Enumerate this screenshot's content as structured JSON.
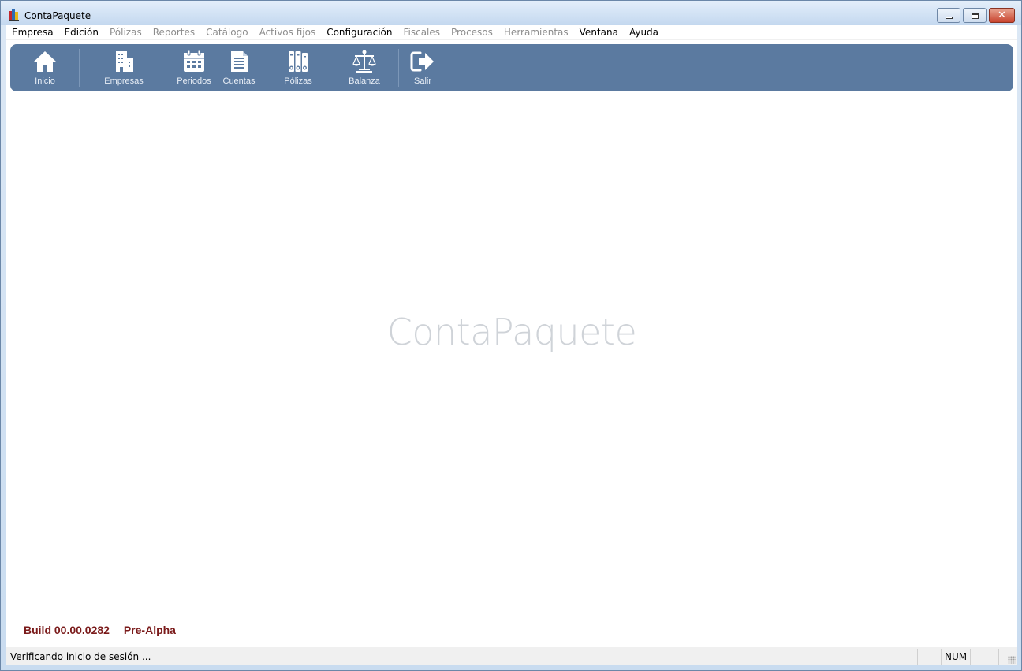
{
  "window": {
    "title": "ContaPaquete",
    "controls": {
      "minimize": "minimize",
      "maximize": "maximize",
      "close": "✕"
    }
  },
  "menu": [
    {
      "label": "Empresa",
      "enabled": true
    },
    {
      "label": "Edición",
      "enabled": true
    },
    {
      "label": "Pólizas",
      "enabled": false
    },
    {
      "label": "Reportes",
      "enabled": false
    },
    {
      "label": "Catálogo",
      "enabled": false
    },
    {
      "label": "Activos fijos",
      "enabled": false
    },
    {
      "label": "Configuración",
      "enabled": true
    },
    {
      "label": "Fiscales",
      "enabled": false
    },
    {
      "label": "Procesos",
      "enabled": false
    },
    {
      "label": "Herramientas",
      "enabled": false
    },
    {
      "label": "Ventana",
      "enabled": true
    },
    {
      "label": "Ayuda",
      "enabled": true
    }
  ],
  "toolbar": {
    "inicio": {
      "label": "Inicio",
      "icon": "home-icon"
    },
    "empresas": {
      "label": "Empresas",
      "icon": "building-icon"
    },
    "periodos": {
      "label": "Periodos",
      "icon": "calendar-icon"
    },
    "cuentas": {
      "label": "Cuentas",
      "icon": "document-list-icon"
    },
    "polizas": {
      "label": "Pólizas",
      "icon": "binders-icon"
    },
    "balanza": {
      "label": "Balanza",
      "icon": "scale-icon"
    },
    "salir": {
      "label": "Salir",
      "icon": "exit-icon"
    }
  },
  "main": {
    "watermark": "ContaPaquete",
    "build_label": "Build 00.00.0282",
    "stage_label": "Pre-Alpha"
  },
  "status": {
    "message": "Verificando inicio de sesión ...",
    "num": "NUM"
  },
  "colors": {
    "toolbar_bg": "#5b7aa0",
    "build_text": "#7a1a1a",
    "watermark": "#cfd3d8",
    "menu_disabled": "#8c8c8c"
  }
}
